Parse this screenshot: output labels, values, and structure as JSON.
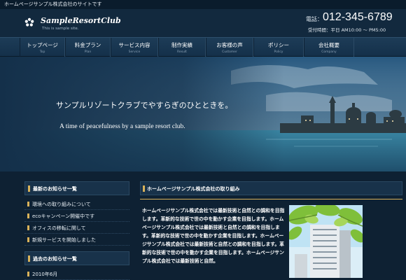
{
  "topbar": {
    "text": "ホームページサンプル株式会社のサイトです"
  },
  "header": {
    "logo_title": "SampleResortClub",
    "logo_subtitle": "This is sample site.",
    "tel_label": "電話：",
    "tel_number": "012-345-6789",
    "hours": "受付時間：平日 AM10:00 ～ PM5:00"
  },
  "nav": [
    {
      "label": "トップページ",
      "sub": "Top"
    },
    {
      "label": "料金プラン",
      "sub": "Plan"
    },
    {
      "label": "サービス内容",
      "sub": "Service"
    },
    {
      "label": "制作実績",
      "sub": "Result"
    },
    {
      "label": "お客様の声",
      "sub": "Customer"
    },
    {
      "label": "ポリシー",
      "sub": "Policy"
    },
    {
      "label": "会社概要",
      "sub": "Company"
    }
  ],
  "hero": {
    "tagline_jp": "サンプルリゾートクラブでやすらぎのひとときを。",
    "tagline_en": "A time of peacefulness by a sample resort club."
  },
  "sidebar": {
    "news_title": "最新のお知らせ一覧",
    "news_items": [
      "環境への取り組みについて",
      "ecoキャンペーン開催中です",
      "オフィスの移転に関して",
      "新規サービスを開始しました"
    ],
    "archive_title": "過去のお知らせ一覧",
    "archive_items": [
      "2010年6月"
    ]
  },
  "main": {
    "title": "ホームページサンプル株式会社の取り組み",
    "body": "ホームページサンプル株式会社では最新技術と自然との調和を目指します。革新的な技術で世の中を動かす企業を目指します。ホームページサンプル株式会社では最新技術と自然との調和を目指します。革新的な技術で世の中を動かす企業を目指します。ホームページサンプル株式会社では最新技術と自然との調和を目指します。革新的な技術で世の中を動かす企業を目指します。ホームページサンプル株式会社では最新技術と自然。"
  },
  "colors": {
    "accent_gold": "#d9b25a",
    "background": "#0f2437",
    "nav": "#1d3c57"
  }
}
